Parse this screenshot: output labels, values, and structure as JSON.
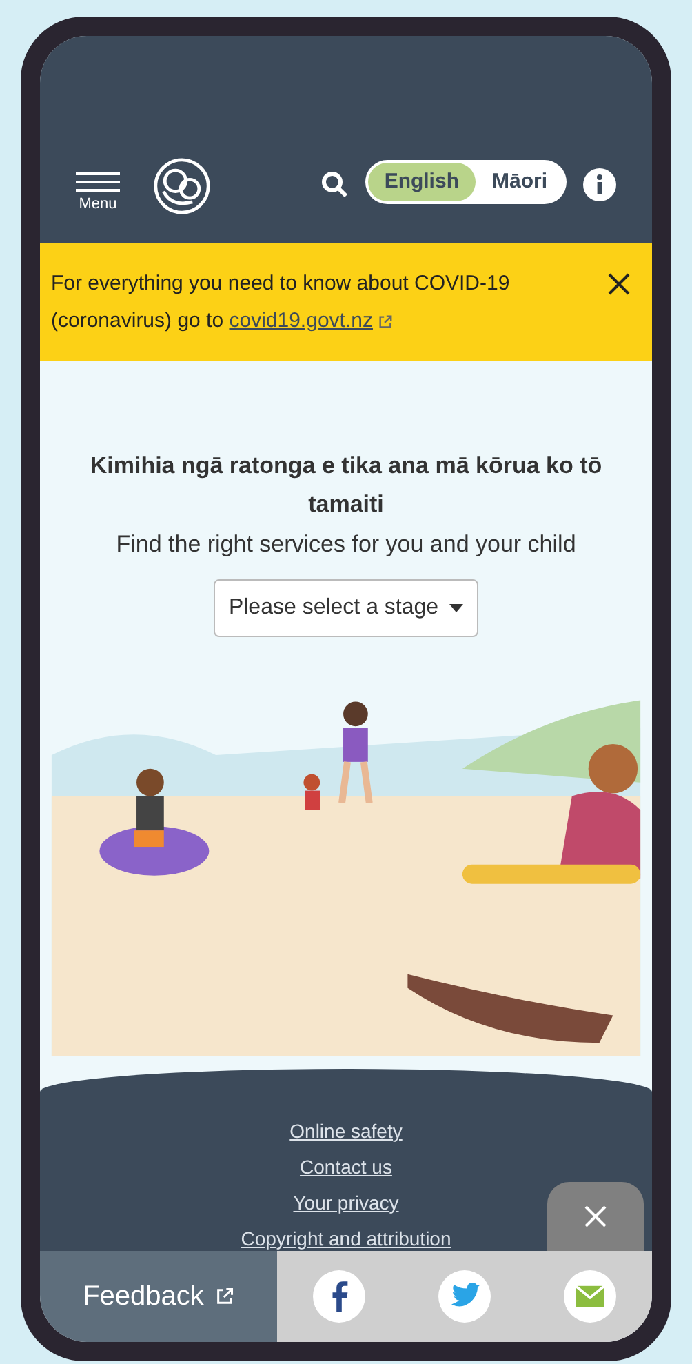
{
  "header": {
    "menu_label": "Menu",
    "languages": [
      {
        "label": "English",
        "selected": true
      },
      {
        "label": "Māori",
        "selected": false
      }
    ]
  },
  "banner": {
    "text": "For everything you need to know about COVID-19 (coronavirus) go to",
    "link": "covid19.govt.nz"
  },
  "hero": {
    "title": "Kimihia ngā ratonga e tika ana mā kōrua ko tō tamaiti",
    "subtitle": "Find the right services for you and your child",
    "select": {
      "value": "Please select a stage"
    }
  },
  "footer": {
    "links": [
      "Online safety",
      "Contact us",
      "Your privacy",
      "Copyright and attribution"
    ]
  },
  "bottom_bar": {
    "feedback": "Feedback"
  }
}
